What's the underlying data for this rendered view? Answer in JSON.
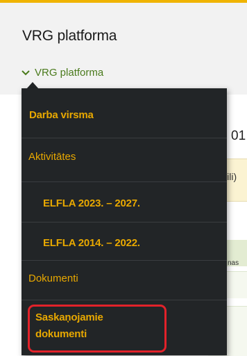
{
  "header": {
    "app_title": "VRG platforma",
    "breadcrumb_label": "VRG platforma"
  },
  "background": {
    "number_fragment": "01",
    "band_fragment": "iili)",
    "column_fragment": "nas"
  },
  "menu": {
    "items": [
      {
        "label": "Darba virsma"
      },
      {
        "label": "Aktivitātes"
      },
      {
        "label": "ELFLA 2023. – 2027."
      },
      {
        "label": "ELFLA 2014. – 2022."
      },
      {
        "label": "Dokumenti"
      },
      {
        "label_line1": "Saskaņojamie",
        "label_line2": "dokumenti"
      }
    ]
  },
  "colors": {
    "menu_background": "#222527",
    "menu_text": "#e8a800",
    "breadcrumb_green": "#4a7a1c",
    "highlight_border": "#e2222a"
  }
}
